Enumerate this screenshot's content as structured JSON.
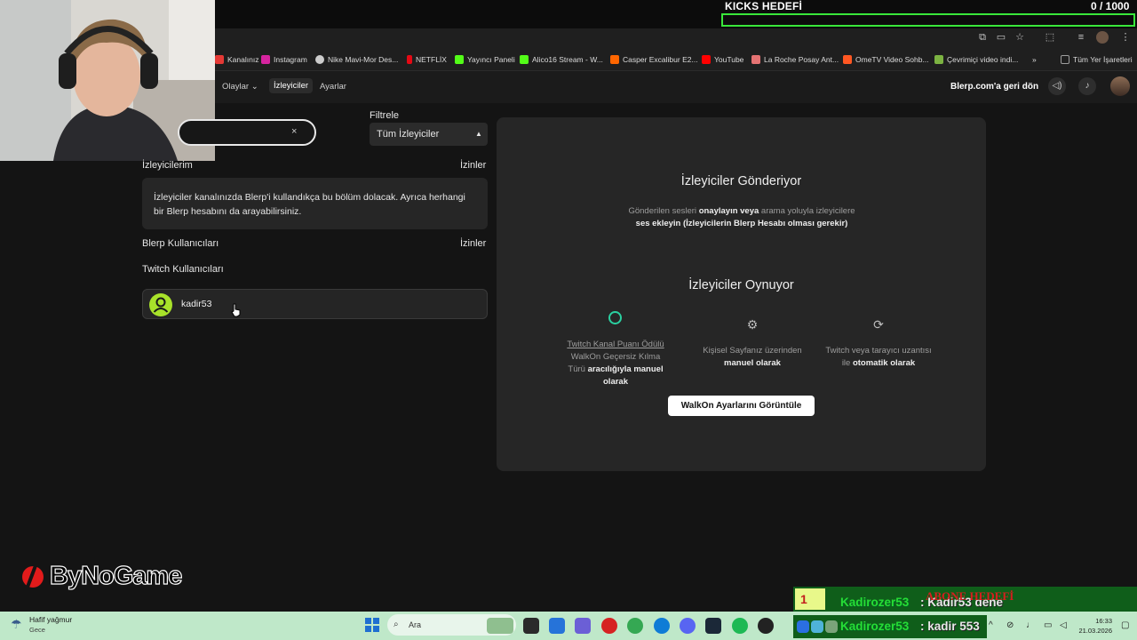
{
  "stream_overlay": {
    "kicks_title": "KICKS HEDEFİ",
    "kicks_count": "0 / 1000",
    "kicks_progress": 0,
    "follow_number": "1",
    "follow_user": "Kadirozer53",
    "follow_message": ": Kadir53 dene",
    "abone_label": "ABONE HEDEFİ",
    "chat_user": "Kadirozer53",
    "chat_message": ": kadir 553",
    "logo_text": "ByNoGame"
  },
  "bookmarks": [
    {
      "label": "Kanalınız",
      "color": "#e53935"
    },
    {
      "label": "Instagram",
      "color": "#d6249f"
    },
    {
      "label": "Nike Mavi-Mor Des...",
      "color": "#cccccc"
    },
    {
      "label": "NETFLİX",
      "color": "#e50914"
    },
    {
      "label": "Yayıncı Paneli",
      "color": "#53fc18"
    },
    {
      "label": "Alico16 Stream - W...",
      "color": "#53fc18"
    },
    {
      "label": "Casper Excalibur E2...",
      "color": "#ff6600"
    },
    {
      "label": "YouTube",
      "color": "#ff0000"
    },
    {
      "label": "La Roche Posay Ant...",
      "color": "#e57373"
    },
    {
      "label": "OmeTV Video Sohb...",
      "color": "#ff5722"
    },
    {
      "label": "Çevrimiçi video indi...",
      "color": "#7cb342"
    },
    {
      "label": "Tüm Yer İşaretleri",
      "color": "#9e9e9e"
    }
  ],
  "nav": {
    "items": [
      "Olaylar",
      "İzleyiciler",
      "Ayarlar"
    ],
    "back_link": "Blerp.com'a geri dön"
  },
  "filter": {
    "label": "Filtrele",
    "value": "Tüm İzleyiciler"
  },
  "search": {
    "clear_icon": "×"
  },
  "sections": {
    "my_viewers": "İzleyicilerim",
    "my_viewers_perms": "İzinler",
    "info_text": "İzleyiciler kanalınızda Blerp'i kullandıkça bu bölüm dolacak. Ayrıca herhangi bir Blerp hesabını da arayabilirsiniz.",
    "blerp_users": "Blerp Kullanıcıları",
    "blerp_users_perms": "İzinler",
    "twitch_users": "Twitch Kullanıcıları"
  },
  "user": {
    "name": "kadir53"
  },
  "right": {
    "sending_title": "İzleyiciler Gönderiyor",
    "sending_desc_1": "Gönderilen sesleri ",
    "sending_desc_2": "onaylayın veya",
    "sending_desc_3": " arama yoluyla izleyicilere ",
    "sending_desc_4": "ses ekleyin (İzleyicilerin Blerp Hesabı olması gerekir)",
    "playing_title": "İzleyiciler Oynuyor",
    "col1_a": "Twitch Kanal Puanı Ödülü",
    "col1_b": " WalkOn Geçersiz Kılma Türü ",
    "col1_c": "aracılığıyla manuel olarak",
    "col2_a": "Kişisel Sayfanız üzerinden ",
    "col2_b": "manuel olarak",
    "col3_a": "Twitch veya tarayıcı uzantısı ile ",
    "col3_b": "otomatik olarak",
    "button": "WalkOn Ayarlarını Görüntüle"
  },
  "taskbar": {
    "weather": "Hafif yağmur",
    "weather_sub": "Gece",
    "search_placeholder": "Ara",
    "time": "16:33",
    "date": "21.03.2026"
  },
  "colors": {
    "accent_green": "#a8e22a",
    "kicks_border": "#39e73a",
    "taskbar": "#bfe8c9"
  }
}
